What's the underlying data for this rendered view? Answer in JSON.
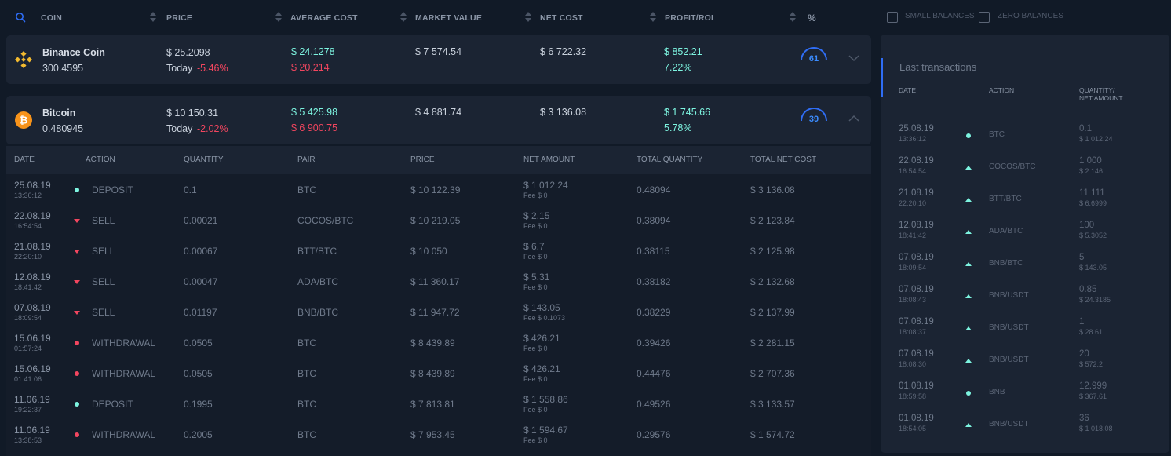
{
  "header": {
    "coin": "COIN",
    "price": "PRICE",
    "average_cost": "AVERAGE COST",
    "market_value": "MARKET VALUE",
    "net_cost": "NET COST",
    "profit_roi": "PROFIT/ROI",
    "percent": "%"
  },
  "filters": {
    "small_balances": "SMALL BALANCES",
    "zero_balances": "ZERO BALANCES"
  },
  "coins": [
    {
      "name": "Binance Coin",
      "amount": "300.4595",
      "price": "$ 25.2098",
      "today_label": "Today",
      "today_change": "-5.46%",
      "avg_cost_pos": "$ 24.1278",
      "avg_cost_neg": "$ 20.214",
      "market_value": "$ 7 574.54",
      "net_cost": "$ 6 722.32",
      "profit": "$ 852.21",
      "roi": "7.22%",
      "gauge": "61",
      "icon": "binance-icon"
    },
    {
      "name": "Bitcoin",
      "amount": "0.480945",
      "price": "$ 10 150.31",
      "today_label": "Today",
      "today_change": "-2.02%",
      "avg_cost_pos": "$ 5 425.98",
      "avg_cost_neg": "$ 6 900.75",
      "market_value": "$ 4 881.74",
      "net_cost": "$ 3 136.08",
      "profit": "$ 1 745.66",
      "roi": "5.78%",
      "gauge": "39",
      "icon": "bitcoin-icon"
    }
  ],
  "tx_table": {
    "headers": [
      "DATE",
      "ACTION",
      "QUANTITY",
      "PAIR",
      "PRICE",
      "NET AMOUNT",
      "TOTAL QUANTITY",
      "TOTAL NET COST"
    ],
    "rows": [
      {
        "date": "25.08.19",
        "time": "13:36:12",
        "marker": "dot-teal",
        "action": "DEPOSIT",
        "quantity": "0.1",
        "pair": "BTC",
        "price": "$ 10 122.39",
        "net": "$ 1 012.24",
        "fee": "Fee $ 0",
        "total_qty": "0.48094",
        "total_cost": "$ 3 136.08"
      },
      {
        "date": "22.08.19",
        "time": "16:54:54",
        "marker": "down-red",
        "action": "SELL",
        "quantity": "0.00021",
        "pair": "COCOS/BTC",
        "price": "$ 10 219.05",
        "net": "$ 2.15",
        "fee": "Fee $ 0",
        "total_qty": "0.38094",
        "total_cost": "$ 2 123.84"
      },
      {
        "date": "21.08.19",
        "time": "22:20:10",
        "marker": "down-red",
        "action": "SELL",
        "quantity": "0.00067",
        "pair": "BTT/BTC",
        "price": "$ 10 050",
        "net": "$ 6.7",
        "fee": "Fee $ 0",
        "total_qty": "0.38115",
        "total_cost": "$ 2 125.98"
      },
      {
        "date": "12.08.19",
        "time": "18:41:42",
        "marker": "down-red",
        "action": "SELL",
        "quantity": "0.00047",
        "pair": "ADA/BTC",
        "price": "$ 11 360.17",
        "net": "$ 5.31",
        "fee": "Fee $ 0",
        "total_qty": "0.38182",
        "total_cost": "$ 2 132.68"
      },
      {
        "date": "07.08.19",
        "time": "18:09:54",
        "marker": "down-red",
        "action": "SELL",
        "quantity": "0.01197",
        "pair": "BNB/BTC",
        "price": "$ 11 947.72",
        "net": "$ 143.05",
        "fee": "Fee $ 0.1073",
        "total_qty": "0.38229",
        "total_cost": "$ 2 137.99"
      },
      {
        "date": "15.06.19",
        "time": "01:57:24",
        "marker": "dot-red",
        "action": "WITHDRAWAL",
        "quantity": "0.0505",
        "pair": "BTC",
        "price": "$ 8 439.89",
        "net": "$ 426.21",
        "fee": "Fee $ 0",
        "total_qty": "0.39426",
        "total_cost": "$ 2 281.15"
      },
      {
        "date": "15.06.19",
        "time": "01:41:06",
        "marker": "dot-red",
        "action": "WITHDRAWAL",
        "quantity": "0.0505",
        "pair": "BTC",
        "price": "$ 8 439.89",
        "net": "$ 426.21",
        "fee": "Fee $ 0",
        "total_qty": "0.44476",
        "total_cost": "$ 2 707.36"
      },
      {
        "date": "11.06.19",
        "time": "19:22:37",
        "marker": "dot-teal",
        "action": "DEPOSIT",
        "quantity": "0.1995",
        "pair": "BTC",
        "price": "$ 7 813.81",
        "net": "$ 1 558.86",
        "fee": "Fee $ 0",
        "total_qty": "0.49526",
        "total_cost": "$ 3 133.57"
      },
      {
        "date": "11.06.19",
        "time": "13:38:53",
        "marker": "dot-red",
        "action": "WITHDRAWAL",
        "quantity": "0.2005",
        "pair": "BTC",
        "price": "$ 7 953.45",
        "net": "$ 1 594.67",
        "fee": "Fee $ 0",
        "total_qty": "0.29576",
        "total_cost": "$ 1 574.72"
      }
    ]
  },
  "last_transactions": {
    "title": "Last transactions",
    "headers": {
      "date": "DATE",
      "action": "ACTION",
      "qty_line1": "QUANTITY/",
      "qty_line2": "NET AMOUNT"
    },
    "rows": [
      {
        "date": "25.08.19",
        "time": "13:36:12",
        "marker": "dot",
        "action": "BTC",
        "qty": "0.1",
        "net": "$ 1 012.24"
      },
      {
        "date": "22.08.19",
        "time": "16:54:54",
        "marker": "up",
        "action": "COCOS/BTC",
        "qty": "1 000",
        "net": "$ 2.146"
      },
      {
        "date": "21.08.19",
        "time": "22:20:10",
        "marker": "up",
        "action": "BTT/BTC",
        "qty": "11 111",
        "net": "$ 6.6999"
      },
      {
        "date": "12.08.19",
        "time": "18:41:42",
        "marker": "up",
        "action": "ADA/BTC",
        "qty": "100",
        "net": "$ 5.3052"
      },
      {
        "date": "07.08.19",
        "time": "18:09:54",
        "marker": "up",
        "action": "BNB/BTC",
        "qty": "5",
        "net": "$ 143.05"
      },
      {
        "date": "07.08.19",
        "time": "18:08:43",
        "marker": "up",
        "action": "BNB/USDT",
        "qty": "0.85",
        "net": "$ 24.3185"
      },
      {
        "date": "07.08.19",
        "time": "18:08:37",
        "marker": "up",
        "action": "BNB/USDT",
        "qty": "1",
        "net": "$ 28.61"
      },
      {
        "date": "07.08.19",
        "time": "18:08:30",
        "marker": "up",
        "action": "BNB/USDT",
        "qty": "20",
        "net": "$ 572.2"
      },
      {
        "date": "01.08.19",
        "time": "18:59:58",
        "marker": "dot",
        "action": "BNB",
        "qty": "12.999",
        "net": "$ 367.61"
      },
      {
        "date": "01.08.19",
        "time": "18:54:05",
        "marker": "up",
        "action": "BNB/USDT",
        "qty": "36",
        "net": "$ 1 018.08"
      }
    ]
  }
}
